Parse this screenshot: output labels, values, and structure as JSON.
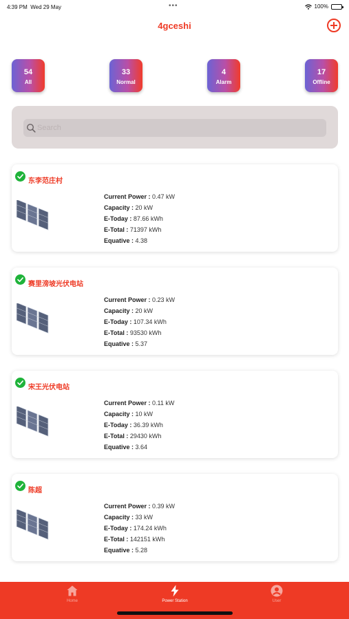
{
  "status_bar": {
    "time": "4:39 PM",
    "date": "Wed 29 May",
    "dots": "•••",
    "battery": "100%"
  },
  "header": {
    "title": "4gceshi",
    "add_icon": "plus-circle-icon"
  },
  "stats": [
    {
      "count": "54",
      "label": "All"
    },
    {
      "count": "33",
      "label": "Normal"
    },
    {
      "count": "4",
      "label": "Alarm"
    },
    {
      "count": "17",
      "label": "Offline"
    }
  ],
  "search": {
    "placeholder": "Search",
    "value": ""
  },
  "stations": [
    {
      "name": "东李范庄村",
      "current_power_label": "Current Power :",
      "current_power": "0.47 kW",
      "capacity_label": "Capacity :",
      "capacity": "20 kW",
      "e_today_label": "E-Today :",
      "e_today": "87.66 kWh",
      "e_total_label": "E-Total :",
      "e_total": "71397 kWh",
      "equative_label": "Equative :",
      "equative": "4.38"
    },
    {
      "name": "赛里滂坡光伏电站",
      "current_power_label": "Current Power :",
      "current_power": "0.23 kW",
      "capacity_label": "Capacity :",
      "capacity": "20 kW",
      "e_today_label": "E-Today :",
      "e_today": "107.34 kWh",
      "e_total_label": "E-Total :",
      "e_total": "93530 kWh",
      "equative_label": "Equative :",
      "equative": "5.37"
    },
    {
      "name": "宋王光伏电站",
      "current_power_label": "Current Power :",
      "current_power": "0.11 kW",
      "capacity_label": "Capacity :",
      "capacity": "10 kW",
      "e_today_label": "E-Today :",
      "e_today": "36.39 kWh",
      "e_total_label": "E-Total :",
      "e_total": "29430 kWh",
      "equative_label": "Equative :",
      "equative": "3.64"
    },
    {
      "name": "陈超",
      "current_power_label": "Current Power :",
      "current_power": "0.39 kW",
      "capacity_label": "Capacity :",
      "capacity": "33 kW",
      "e_today_label": "E-Today :",
      "e_today": "174.24 kWh",
      "e_total_label": "E-Total :",
      "e_total": "142151 kWh",
      "equative_label": "Equative :",
      "equative": "5.28"
    }
  ],
  "tabs": [
    {
      "label": "Home",
      "icon": "home-icon"
    },
    {
      "label": "Power Station",
      "icon": "lightning-icon"
    },
    {
      "label": "User",
      "icon": "user-icon"
    }
  ],
  "colors": {
    "accent": "#ee3a25",
    "status_ok": "#1fb33a",
    "stat_gradient_start": "#6c63d4",
    "stat_gradient_end": "#f03c2c",
    "search_panel": "#e0d9d9"
  }
}
